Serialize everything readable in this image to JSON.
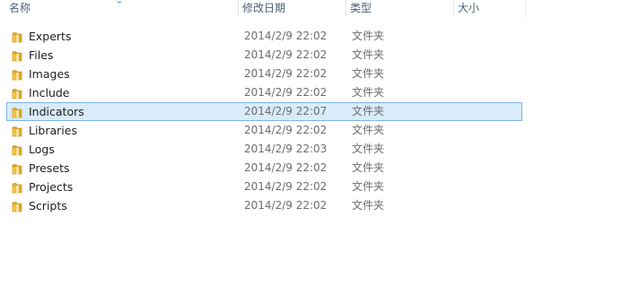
{
  "columns": {
    "name": "名称",
    "date": "修改日期",
    "type": "类型",
    "size": "大小"
  },
  "colors": {
    "header_text": "#4c607a",
    "detail_text": "#6d6d6d",
    "selection_fill": "#d9ecfa",
    "selection_border": "#7eb4ea",
    "folder_yellow": "#f5c542"
  },
  "files": [
    {
      "name": "Experts",
      "date": "2014/2/9 22:02",
      "type": "文件夹",
      "size": "",
      "icon": "folder-icon",
      "selected": false
    },
    {
      "name": "Files",
      "date": "2014/2/9 22:02",
      "type": "文件夹",
      "size": "",
      "icon": "folder-icon",
      "selected": false
    },
    {
      "name": "Images",
      "date": "2014/2/9 22:02",
      "type": "文件夹",
      "size": "",
      "icon": "folder-icon",
      "selected": false
    },
    {
      "name": "Include",
      "date": "2014/2/9 22:02",
      "type": "文件夹",
      "size": "",
      "icon": "folder-icon",
      "selected": false
    },
    {
      "name": "Indicators",
      "date": "2014/2/9 22:07",
      "type": "文件夹",
      "size": "",
      "icon": "folder-icon",
      "selected": true
    },
    {
      "name": "Libraries",
      "date": "2014/2/9 22:02",
      "type": "文件夹",
      "size": "",
      "icon": "folder-icon",
      "selected": false
    },
    {
      "name": "Logs",
      "date": "2014/2/9 22:03",
      "type": "文件夹",
      "size": "",
      "icon": "folder-icon",
      "selected": false
    },
    {
      "name": "Presets",
      "date": "2014/2/9 22:02",
      "type": "文件夹",
      "size": "",
      "icon": "folder-icon",
      "selected": false
    },
    {
      "name": "Projects",
      "date": "2014/2/9 22:02",
      "type": "文件夹",
      "size": "",
      "icon": "folder-icon",
      "selected": false
    },
    {
      "name": "Scripts",
      "date": "2014/2/9 22:02",
      "type": "文件夹",
      "size": "",
      "icon": "folder-icon",
      "selected": false
    }
  ]
}
